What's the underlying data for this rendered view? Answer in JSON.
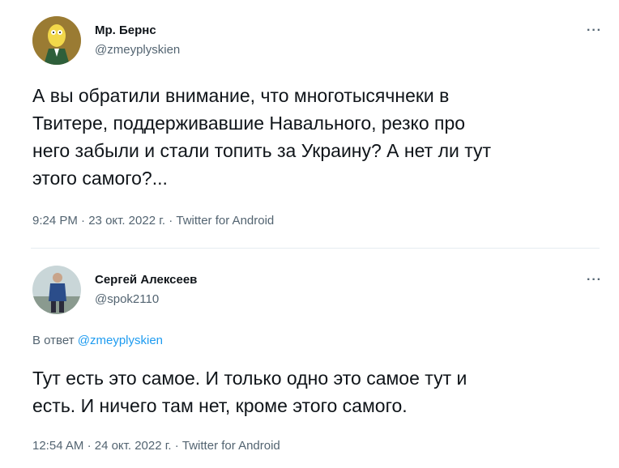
{
  "tweet1": {
    "author_name": "Мр. Бернс",
    "handle": "@zmeyplyskien",
    "more": "···",
    "text": "А вы обратили внимание, что многотысячнеки в\nТвитере,  поддерживавшие Навального, резко про\nнего забыли и стали топить за Украину? А нет ли тут\nэтого самого?...",
    "time": "9:24 PM",
    "date": "23 окт. 2022 г.",
    "source": "Twitter for Android",
    "sep": "·"
  },
  "tweet2": {
    "author_name": "Сергей Алексеев",
    "handle": "@spok2110",
    "more": "···",
    "reply_prefix": "В ответ",
    "reply_handle": "@zmeyplyskien",
    "text": "Тут есть это самое. И только одно это самое тут и\nесть. И ничего там нет, кроме этого самого.",
    "time": "12:54 AM",
    "date": "24 окт. 2022 г.",
    "source": "Twitter for Android",
    "sep": "·"
  }
}
